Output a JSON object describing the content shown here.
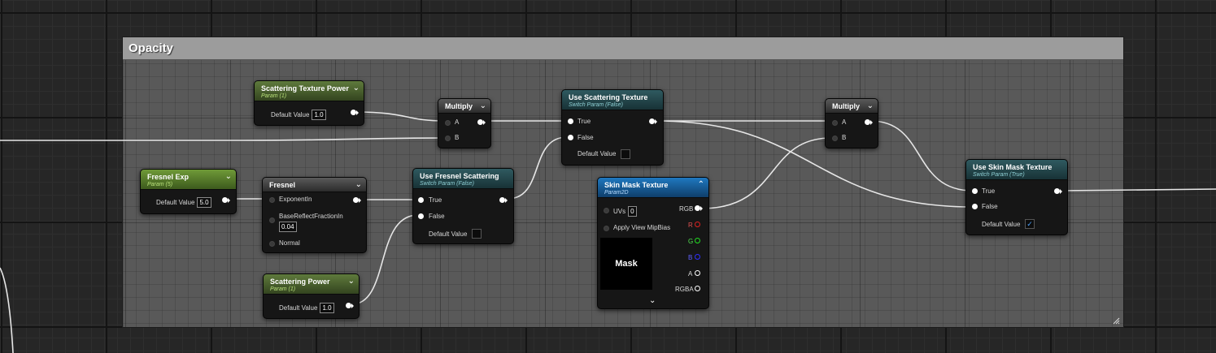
{
  "comment": {
    "title": "Opacity"
  },
  "nodes": {
    "scattering_texture_power": {
      "title": "Scattering Texture Power",
      "subtitle": "Param (1)",
      "label": "Default Value",
      "value": "1.0"
    },
    "multiply1": {
      "title": "Multiply",
      "a": "A",
      "b": "B"
    },
    "use_scattering_texture": {
      "title": "Use Scattering Texture",
      "subtitle": "Switch Param (False)",
      "true_label": "True",
      "false_label": "False",
      "default_label": "Default Value",
      "default_checked": false
    },
    "multiply2": {
      "title": "Multiply",
      "a": "A",
      "b": "B"
    },
    "fresnel_exp": {
      "title": "Fresnel Exp",
      "subtitle": "Param (5)",
      "label": "Default Value",
      "value": "5.0"
    },
    "fresnel": {
      "title": "Fresnel",
      "in1": "ExponentIn",
      "in2": "BaseReflectFractionIn",
      "in2_value": "0.04",
      "in3": "Normal"
    },
    "use_fresnel_scattering": {
      "title": "Use Fresnel Scattering",
      "subtitle": "Switch Param (False)",
      "true_label": "True",
      "false_label": "False",
      "default_label": "Default Value",
      "default_checked": false
    },
    "skin_mask_texture": {
      "title": "Skin Mask Texture",
      "subtitle": "Param2D",
      "uvs_label": "UVs",
      "uvs_value": "0",
      "mip_label": "Apply View MipBias",
      "out_rgb": "RGB",
      "out_r": "R",
      "out_g": "G",
      "out_b": "B",
      "out_a": "A",
      "out_rgba": "RGBA",
      "preview_text": "Mask"
    },
    "use_skin_mask_texture": {
      "title": "Use Skin Mask Texture",
      "subtitle": "Switch Param (True)",
      "true_label": "True",
      "false_label": "False",
      "default_label": "Default Value",
      "default_checked": true
    },
    "scattering_power": {
      "title": "Scattering Power",
      "subtitle": "Param (1)",
      "label": "Default Value",
      "value": "1.0"
    }
  },
  "icons": {
    "collapse": "chevron-down-icon",
    "expand": "chevron-up-icon",
    "check": "checkmark-icon"
  },
  "colors": {
    "param_header": "#5f7a3c",
    "switch_header": "#2f5a60",
    "texture_header": "#1f78c0",
    "comment_header": "#9c9c9c"
  }
}
